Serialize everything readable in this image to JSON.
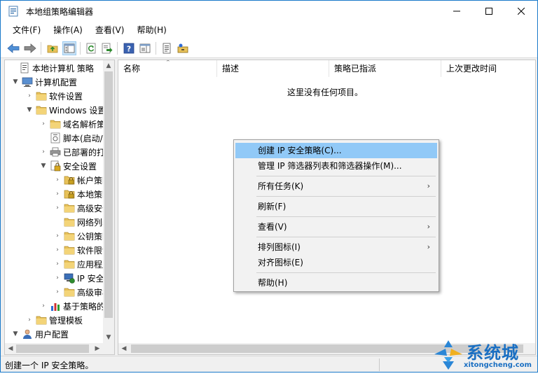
{
  "window": {
    "title": "本地组策略编辑器"
  },
  "menubar": [
    {
      "label": "文件(F)"
    },
    {
      "label": "操作(A)"
    },
    {
      "label": "查看(V)"
    },
    {
      "label": "帮助(H)"
    }
  ],
  "tree": {
    "items": [
      {
        "label": "本地计算机 策略",
        "arrow": "",
        "icon": "computer-policy-icon"
      },
      {
        "label": "计算机配置",
        "arrow": "▼",
        "icon": "computer-icon"
      },
      {
        "label": "软件设置",
        "arrow": "›",
        "icon": "folder-icon"
      },
      {
        "label": "Windows 设置",
        "arrow": "▼",
        "icon": "folder-icon"
      },
      {
        "label": "域名解析策略",
        "arrow": "›",
        "icon": "folder-icon"
      },
      {
        "label": "脚本(启动/关机)",
        "arrow": "",
        "icon": "script-icon"
      },
      {
        "label": "已部署的打印机",
        "arrow": "›",
        "icon": "printer-icon"
      },
      {
        "label": "安全设置",
        "arrow": "▼",
        "icon": "security-icon"
      },
      {
        "label": "帐户策略",
        "arrow": "›",
        "icon": "folder-lock-icon"
      },
      {
        "label": "本地策略",
        "arrow": "›",
        "icon": "folder-lock-icon"
      },
      {
        "label": "高级安全",
        "arrow": "›",
        "icon": "folder-icon"
      },
      {
        "label": "网络列表",
        "arrow": "",
        "icon": "folder-icon"
      },
      {
        "label": "公钥策略",
        "arrow": "›",
        "icon": "folder-icon"
      },
      {
        "label": "软件限制",
        "arrow": "›",
        "icon": "folder-icon"
      },
      {
        "label": "应用程序",
        "arrow": "›",
        "icon": "folder-icon"
      },
      {
        "label": "IP 安全策略",
        "arrow": "›",
        "icon": "ip-security-icon"
      },
      {
        "label": "高级审核",
        "arrow": "›",
        "icon": "folder-icon"
      },
      {
        "label": "基于策略的QoS",
        "arrow": "›",
        "icon": "chart-icon"
      },
      {
        "label": "管理模板",
        "arrow": "›",
        "icon": "folder-icon"
      },
      {
        "label": "用户配置",
        "arrow": "▼",
        "icon": "user-icon"
      }
    ]
  },
  "list": {
    "columns": [
      {
        "label": "名称"
      },
      {
        "label": "描述"
      },
      {
        "label": "策略已指派"
      },
      {
        "label": "上次更改时间"
      }
    ],
    "empty_message": "这里没有任何项目。"
  },
  "context_menu": {
    "items": [
      {
        "label": "创建 IP 安全策略(C)...",
        "highlighted": true,
        "submenu": false
      },
      {
        "label": "管理 IP 筛选器列表和筛选器操作(M)...",
        "highlighted": false,
        "submenu": false
      },
      {
        "label": "所有任务(K)",
        "highlighted": false,
        "submenu": true
      },
      {
        "label": "刷新(F)",
        "highlighted": false,
        "submenu": false
      },
      {
        "label": "查看(V)",
        "highlighted": false,
        "submenu": true
      },
      {
        "label": "排列图标(I)",
        "highlighted": false,
        "submenu": true
      },
      {
        "label": "对齐图标(E)",
        "highlighted": false,
        "submenu": false
      },
      {
        "label": "帮助(H)",
        "highlighted": false,
        "submenu": false
      }
    ],
    "submenu_glyph": "›"
  },
  "statusbar": {
    "text": "创建一个 IP 安全策略。"
  },
  "watermark": {
    "brand": "系统城",
    "url": "xitongcheng.com"
  },
  "colors": {
    "accent": "#1979ca",
    "menu_highlight": "#91c9f7",
    "folder": "#e8c25a"
  }
}
